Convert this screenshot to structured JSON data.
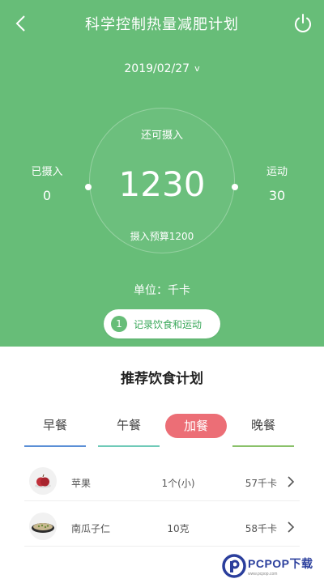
{
  "header": {
    "title": "科学控制热量减肥计划",
    "back_icon": "chevron-left-icon",
    "power_icon": "power-icon"
  },
  "date": {
    "value": "2019/02/27",
    "chevron": "v"
  },
  "summary": {
    "remain_label": "还可摄入",
    "remain_value": "1230",
    "budget_label": "摄入预算1200",
    "intake_label": "已摄入",
    "intake_value": "0",
    "exercise_label": "运动",
    "exercise_value": "30",
    "unit_label": "单位：千卡"
  },
  "record": {
    "step": "1",
    "label": "记录饮食和运动"
  },
  "plan": {
    "title": "推荐饮食计划",
    "tabs": [
      {
        "label": "早餐",
        "color": "#5b8fd6"
      },
      {
        "label": "午餐",
        "color": "#6fcab8"
      },
      {
        "label": "加餐",
        "color": "#ec6e76",
        "active": true
      },
      {
        "label": "晚餐",
        "color": "#8ac16a"
      }
    ],
    "foods": [
      {
        "name": "苹果",
        "qty": "1个(小)",
        "cal": "57千卡"
      },
      {
        "name": "南瓜子仁",
        "qty": "10克",
        "cal": "58千卡"
      }
    ]
  },
  "colors": {
    "primary": "#67bd78",
    "accent": "#ec6e76"
  },
  "watermark": {
    "main": "PCPOP下载",
    "sub": "www.pcpop.com"
  }
}
